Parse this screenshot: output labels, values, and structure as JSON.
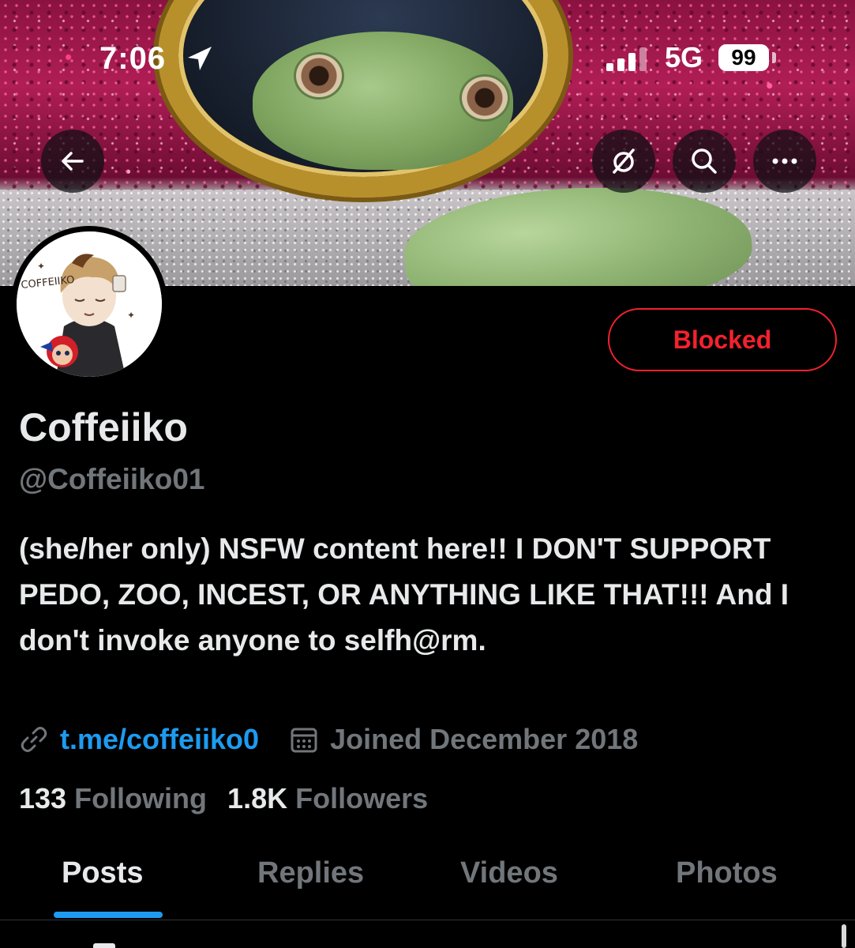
{
  "status_bar": {
    "time": "7:06",
    "network": "5G",
    "battery": "99"
  },
  "banner": {
    "icons": {
      "back": "back-arrow-icon",
      "grok": "grok-icon",
      "search": "search-icon",
      "more": "more-icon"
    }
  },
  "avatar": {
    "signature": "COFFEIIKO"
  },
  "actions": {
    "blocked_label": "Blocked"
  },
  "profile": {
    "display_name": "Coffeiiko",
    "handle": "@Coffeiiko01",
    "bio": "(she/her only) NSFW content here!! I DON'T SUPPORT PEDO, ZOO, INCEST, OR ANYTHING LIKE THAT!!! And I don't invoke anyone to selfh@rm.",
    "link": "t.me/coffeiiko0",
    "joined": "Joined December 2018"
  },
  "stats": {
    "following_count": "133",
    "following_label": "Following",
    "followers_count": "1.8K",
    "followers_label": "Followers"
  },
  "tabs": [
    {
      "label": "Posts",
      "active": true
    },
    {
      "label": "Replies",
      "active": false
    },
    {
      "label": "Videos",
      "active": false
    },
    {
      "label": "Photos",
      "active": false
    }
  ],
  "colors": {
    "accent": "#1d9bf0",
    "blocked_red": "#f4212e",
    "secondary_text": "#71767b",
    "primary_text": "#e7e9ea",
    "background": "#000000"
  }
}
